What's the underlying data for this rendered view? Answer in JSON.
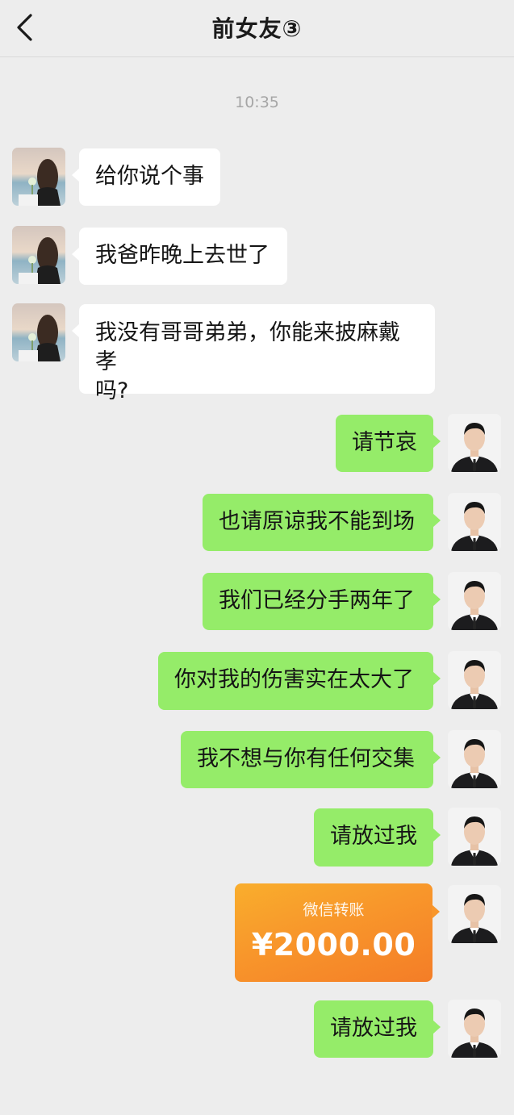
{
  "header": {
    "title": "前女友③",
    "back_icon": "chevron-left-icon"
  },
  "timestamp": "10:35",
  "messages_incoming": [
    {
      "text": "给你说个事"
    },
    {
      "text": "我爸昨晚上去世了"
    },
    {
      "text": "我没有哥哥弟弟，你能来披麻戴孝"
    },
    {
      "text": "吗?"
    }
  ],
  "messages_outgoing": [
    {
      "text": "请节哀"
    },
    {
      "text": "也请原谅我不能到场"
    },
    {
      "text": "我们已经分手两年了"
    },
    {
      "text": "你对我的伤害实在太大了"
    },
    {
      "text": "我不想与你有任何交集"
    },
    {
      "text": "请放过我"
    },
    {
      "text": "请放过我"
    }
  ],
  "transfer": {
    "label": "微信转账",
    "amount": "¥2000.00"
  },
  "colors": {
    "background": "#ededed",
    "incoming_bubble": "#ffffff",
    "outgoing_bubble": "#95ec69",
    "transfer_orange": "#f8962b",
    "timestamp": "#a6a6a6"
  }
}
